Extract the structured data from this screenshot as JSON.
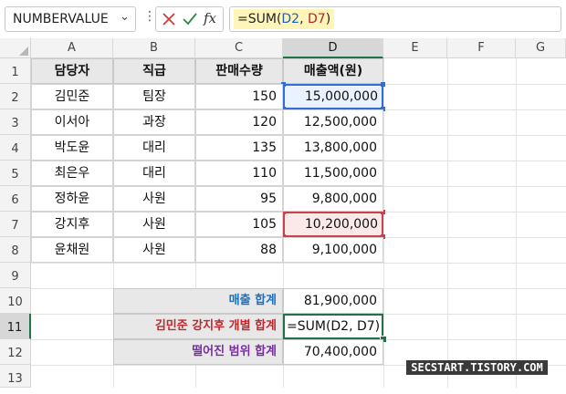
{
  "formula_bar": {
    "name_box": "NUMBERVALUE",
    "formula_prefix": "=SUM(",
    "ref1": "D2",
    "sep": ", ",
    "ref2": "D7",
    "formula_suffix": ")",
    "icons": [
      "chevron-down-icon",
      "more-vertical-icon",
      "cancel-icon",
      "check-icon",
      "fx-icon"
    ]
  },
  "columns": [
    "A",
    "B",
    "C",
    "D",
    "E",
    "F",
    "G"
  ],
  "rows": [
    "1",
    "2",
    "3",
    "4",
    "5",
    "6",
    "7",
    "8",
    "9",
    "10",
    "11",
    "12",
    "13"
  ],
  "table": {
    "headers": [
      "담당자",
      "직급",
      "판매수량",
      "매출액(원)"
    ],
    "rows": [
      [
        "김민준",
        "팀장",
        "150",
        "15,000,000"
      ],
      [
        "이서아",
        "과장",
        "120",
        "12,500,000"
      ],
      [
        "박도윤",
        "대리",
        "135",
        "13,800,000"
      ],
      [
        "최은우",
        "대리",
        "110",
        "11,500,000"
      ],
      [
        "정하윤",
        "사원",
        "95",
        "9,800,000"
      ],
      [
        "강지후",
        "사원",
        "105",
        "10,200,000"
      ],
      [
        "윤채원",
        "사원",
        "88",
        "9,100,000"
      ]
    ]
  },
  "summary": {
    "total_label": "매출 합계",
    "total_value": "81,900,000",
    "editing_label": "김민준 강지후 개별 합계",
    "editing_value": "=SUM(D2, D7)",
    "gap_label": "떨어진 범위 합계",
    "gap_value": "70,400,000"
  },
  "colors": {
    "total_label": "#1f6fbf",
    "editing_label": "#c0282e",
    "gap_label": "#7a2aa3",
    "ref_blue": "#2f6fd6",
    "ref_red": "#c8434c",
    "active": "#217346"
  },
  "watermark": "SECSTART.TISTORY.COM"
}
